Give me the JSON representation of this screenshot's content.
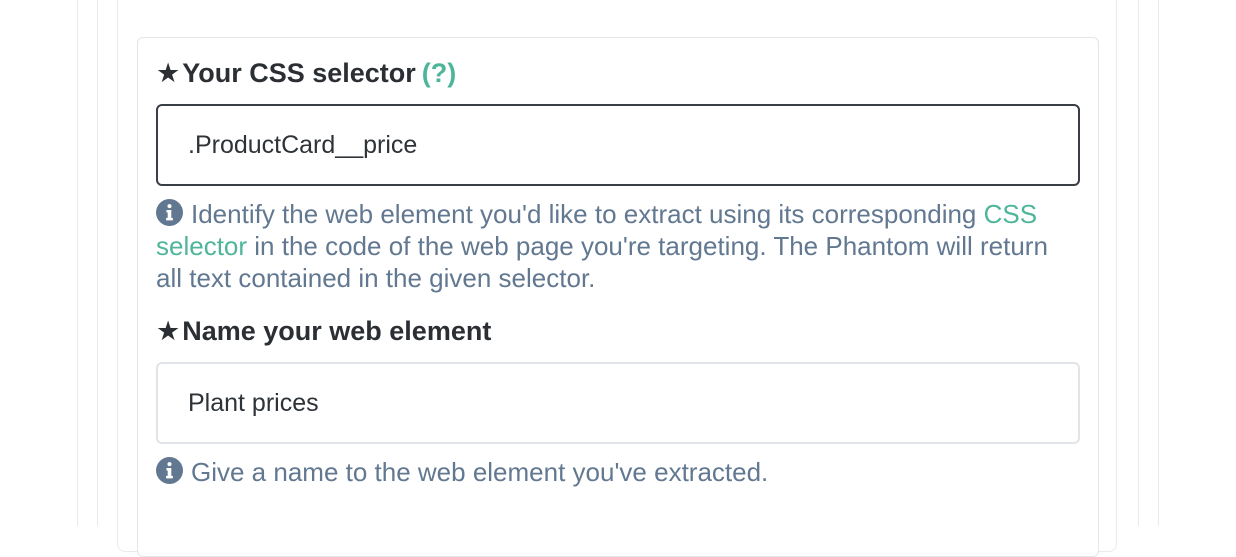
{
  "fields": [
    {
      "label": "Your CSS selector",
      "required_marker": "★",
      "help_link": "(?)",
      "value": ".ProductCard__price",
      "hint_text_1": "Identify the web element you'd like to extract using its corresponding",
      "hint_link": "CSS selector",
      "hint_text_2": " in the code of the web page you're targeting. The Phantom will return all text contained in the given selector.",
      "icon": "info-circle-icon"
    },
    {
      "label": "Name your web element",
      "required_marker": "★",
      "value": "Plant prices",
      "hint_text": "Give a name to the web element you've extracted.",
      "icon": "info-circle-icon"
    }
  ],
  "colors": {
    "accent": "#4fb59a",
    "hint": "#627891",
    "label": "#2b2f33"
  }
}
